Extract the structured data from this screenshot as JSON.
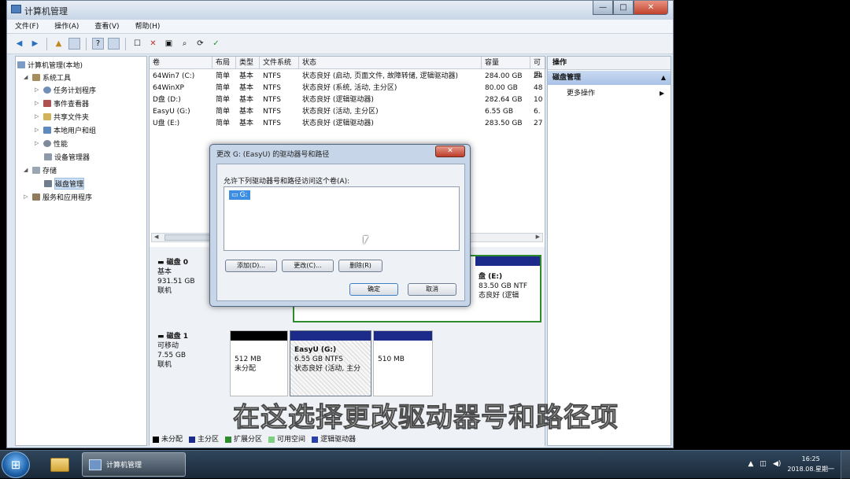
{
  "window": {
    "title": "计算机管理",
    "buttons": {
      "minimize": "—",
      "maximize": "□",
      "close": "✕"
    }
  },
  "menu": [
    "文件(F)",
    "操作(A)",
    "查看(V)",
    "帮助(H)"
  ],
  "tree": {
    "root": "计算机管理(本地)",
    "system_tools": "系统工具",
    "task_scheduler": "任务计划程序",
    "event_viewer": "事件查看器",
    "shared_folders": "共享文件夹",
    "local_users": "本地用户和组",
    "performance": "性能",
    "device_manager": "设备管理器",
    "storage": "存储",
    "disk_management": "磁盘管理",
    "services": "服务和应用程序"
  },
  "volume_table": {
    "headers": [
      "卷",
      "布局",
      "类型",
      "文件系统",
      "状态",
      "容量",
      "可用"
    ],
    "rows": [
      {
        "name": "64Win7 (C:)",
        "layout": "简单",
        "type": "基本",
        "fs": "NTFS",
        "status": "状态良好 (启动, 页面文件, 故障转储, 逻辑驱动器)",
        "capacity": "284.00 GB",
        "free": "24"
      },
      {
        "name": "64WinXP",
        "layout": "简单",
        "type": "基本",
        "fs": "NTFS",
        "status": "状态良好 (系统, 活动, 主分区)",
        "capacity": "80.00 GB",
        "free": "48"
      },
      {
        "name": "D盘 (D:)",
        "layout": "简单",
        "type": "基本",
        "fs": "NTFS",
        "status": "状态良好 (逻辑驱动器)",
        "capacity": "282.64 GB",
        "free": "10"
      },
      {
        "name": "EasyU (G:)",
        "layout": "简单",
        "type": "基本",
        "fs": "NTFS",
        "status": "状态良好 (活动, 主分区)",
        "capacity": "6.55 GB",
        "free": "6."
      },
      {
        "name": "U盘 (E:)",
        "layout": "简单",
        "type": "基本",
        "fs": "NTFS",
        "status": "状态良好 (逻辑驱动器)",
        "capacity": "283.50 GB",
        "free": "27"
      }
    ]
  },
  "disks": {
    "disk0": {
      "name": "磁盘 0",
      "type": "基本",
      "size": "931.51 GB",
      "state": "联机",
      "visible_part": {
        "label": "盘 (E:)",
        "line2": "83.50 GB NTF",
        "line3": "态良好 (逻辑"
      }
    },
    "disk1": {
      "name": "磁盘 1",
      "type": "可移动",
      "size": "7.55 GB",
      "state": "联机",
      "parts": [
        {
          "size": "512 MB",
          "status": "未分配",
          "bar": "#000000"
        },
        {
          "title": "EasyU (G:)",
          "size": "6.55 GB NTFS",
          "status": "状态良好 (活动, 主分",
          "bar": "#1c2a8a"
        },
        {
          "size": "510 MB",
          "status": "",
          "bar": "#1c2a8a"
        }
      ]
    }
  },
  "legend": [
    {
      "label": "未分配",
      "color": "#000000"
    },
    {
      "label": "主分区",
      "color": "#1c2a8a"
    },
    {
      "label": "扩展分区",
      "color": "#2e8b2e"
    },
    {
      "label": "可用空间",
      "color": "#7ccf7c"
    },
    {
      "label": "逻辑驱动器",
      "color": "#2b3fa8"
    }
  ],
  "actions": {
    "header": "操作",
    "group": "磁盘管理",
    "more": "更多操作"
  },
  "dialog": {
    "title": "更改 G: (EasyU) 的驱动器号和路径",
    "prompt": "允许下列驱动器号和路径访问这个卷(A):",
    "list_item": "G:",
    "add": "添加(D)...",
    "change": "更改(C)...",
    "remove": "删除(R)",
    "ok": "确定",
    "cancel": "取消"
  },
  "caption": "在这选择更改驱动器号和路径项",
  "taskbar": {
    "active_app": "计算机管理",
    "time": "16:25",
    "date": "2018.08.星期一"
  }
}
